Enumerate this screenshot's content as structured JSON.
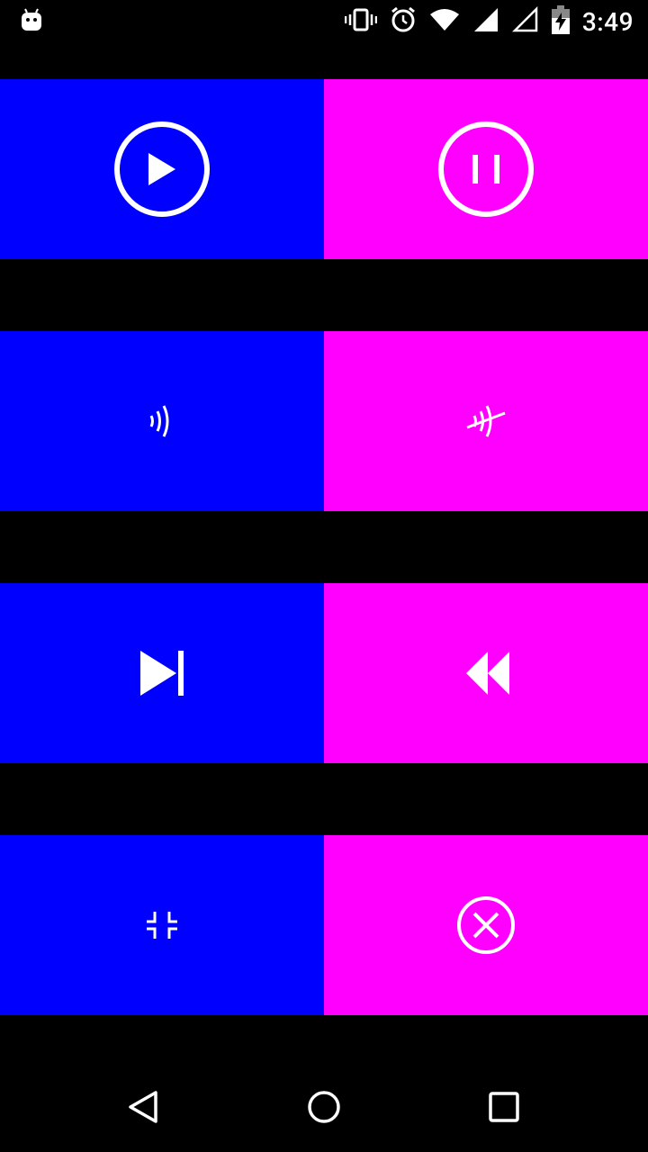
{
  "status_bar": {
    "time": "3:49",
    "icons": [
      "android-icon",
      "vibrate-icon",
      "alarm-icon",
      "wifi-icon",
      "signal-icon",
      "signal-empty-icon",
      "battery-charging-icon"
    ]
  },
  "colors": {
    "left_tile": "#0000FF",
    "right_tile": "#FF00FF",
    "background": "#000000",
    "icon": "#FFFFFF"
  },
  "tiles": [
    {
      "name": "play-button",
      "icon": "play-circle-icon",
      "color": "#0000FF"
    },
    {
      "name": "pause-button",
      "icon": "pause-circle-icon",
      "color": "#FF00FF"
    },
    {
      "name": "sound-waves-button",
      "icon": "sound-waves-icon",
      "color": "#0000FF"
    },
    {
      "name": "sound-waves-off-button",
      "icon": "sound-waves-off-icon",
      "color": "#FF00FF"
    },
    {
      "name": "skip-next-button",
      "icon": "skip-next-icon",
      "color": "#0000FF"
    },
    {
      "name": "rewind-button",
      "icon": "rewind-icon",
      "color": "#FF00FF"
    },
    {
      "name": "fullscreen-exit-button",
      "icon": "fullscreen-exit-icon",
      "color": "#0000FF"
    },
    {
      "name": "cancel-button",
      "icon": "cancel-circle-icon",
      "color": "#FF00FF"
    }
  ],
  "nav_bar": {
    "buttons": [
      "back-icon",
      "home-icon",
      "recents-icon"
    ]
  }
}
